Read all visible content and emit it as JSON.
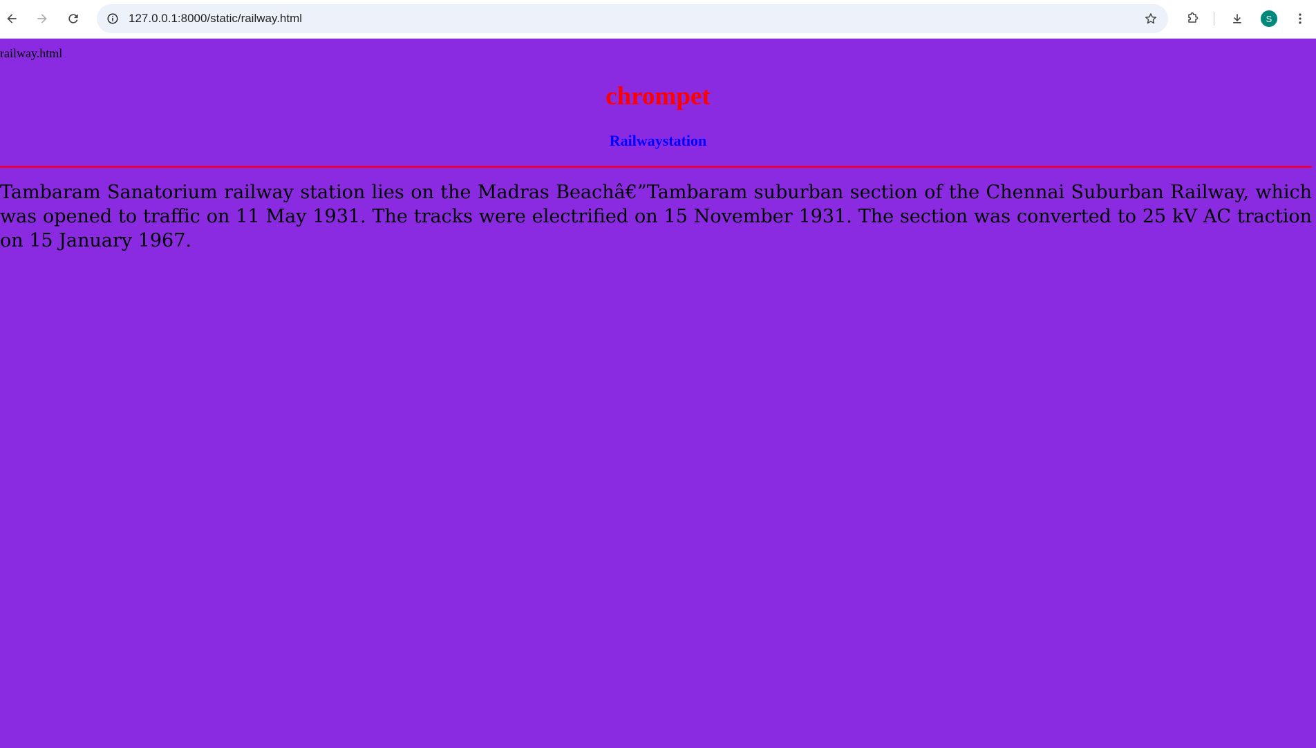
{
  "browser": {
    "url": "127.0.0.1:8000/static/railway.html",
    "profile_initial": "S",
    "icons": [
      "back-arrow-icon",
      "forward-arrow-icon",
      "reload-icon",
      "site-info-icon",
      "bookmark-star-icon",
      "extensions-icon",
      "download-icon",
      "more-vert-icon"
    ]
  },
  "page": {
    "file_label": "railway.html",
    "heading": "chrompet",
    "subheading": "Railwaystation",
    "paragraph": "Tambaram Sanatorium railway station lies on the Madras Beachâ€”Tambaram suburban section of the Chennai Suburban Railway, which was opened to traffic on 11 May 1931. The tracks were electrified on 15 November 1931. The section was converted to 25 kV AC traction on 15 January 1967.",
    "colors": {
      "background": "#8a2be2",
      "heading": "#ff0000",
      "subheading": "#0000ff",
      "rule": "#e8003c"
    }
  }
}
